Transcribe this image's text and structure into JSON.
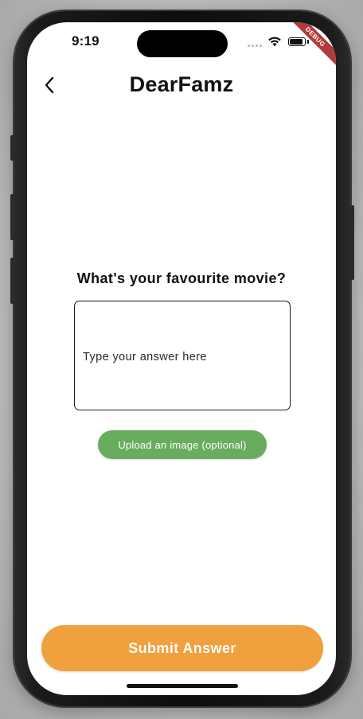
{
  "status_bar": {
    "time": "9:19",
    "debug_label": "DEBUG",
    "battery_level": 0.9
  },
  "app_bar": {
    "title": "DearFamz",
    "back_icon": "chevron-left-icon"
  },
  "question": {
    "text": "What's your favourite movie?"
  },
  "answer": {
    "value": "",
    "placeholder": "Type your answer here"
  },
  "upload": {
    "label": "Upload an image (optional)"
  },
  "submit": {
    "label": "Submit Answer"
  },
  "colors": {
    "upload_button": "#68ad5e",
    "submit_button": "#f0a03c",
    "debug_ribbon": "#b13a3a"
  }
}
